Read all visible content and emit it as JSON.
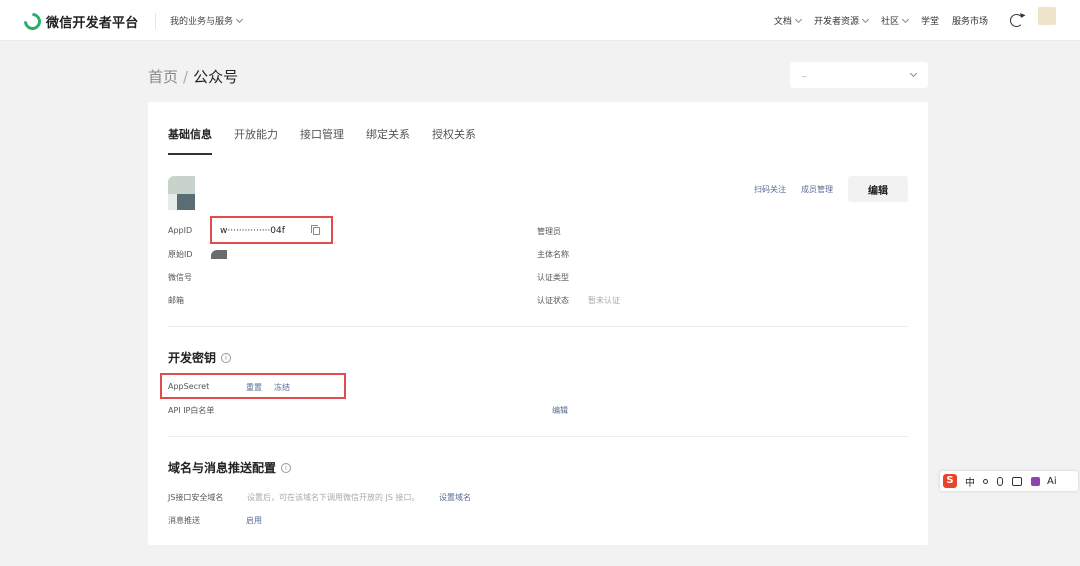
{
  "topnav": {
    "logo_text": "微信开发者平台",
    "biz_menu": "我的业务与服务",
    "items": [
      "文档",
      "开发者资源",
      "社区",
      "学堂",
      "服务市场"
    ],
    "dropdown_items": [
      true,
      true,
      true,
      false,
      false
    ]
  },
  "breadcrumb": {
    "home": "首页",
    "separator": "/",
    "current": "公众号"
  },
  "account_select": {
    "value": "_"
  },
  "tabs": [
    "基础信息",
    "开放能力",
    "接口管理",
    "绑定关系",
    "授权关系"
  ],
  "account_actions": {
    "scan_follow": "扫码关注",
    "member_manage": "成员管理",
    "edit": "编辑"
  },
  "basic_info": {
    "appid_label": "AppID",
    "appid_value": "w···············04f",
    "original_id_label": "原始ID",
    "wechat_id_label": "微信号",
    "email_label": "邮箱",
    "admin_label": "管理员",
    "entity_label": "主体名称",
    "cert_type_label": "认证类型",
    "cert_status_label": "认证状态",
    "cert_status_value": "暂未认证"
  },
  "dev_key": {
    "title": "开发密钥",
    "appsecret_label": "AppSecret",
    "reset": "重置",
    "freeze": "冻结",
    "ip_whitelist_label": "API IP白名单",
    "ip_whitelist_edit": "编辑"
  },
  "domain_config": {
    "title": "域名与消息推送配置",
    "js_domain_label": "JS接口安全域名",
    "js_domain_hint": "设置后，可在该域名下调用微信开放的 JS 接口。",
    "js_domain_link": "设置域名",
    "msg_push_label": "消息推送",
    "msg_push_link": "启用"
  },
  "ime": {
    "logo": "S",
    "lang": "中",
    "ai": "Ai"
  },
  "colors": {
    "brand_green": "#2aae67",
    "link_blue": "#576b95",
    "highlight_red": "#e24b4b",
    "page_bg": "#f2f2f2"
  }
}
